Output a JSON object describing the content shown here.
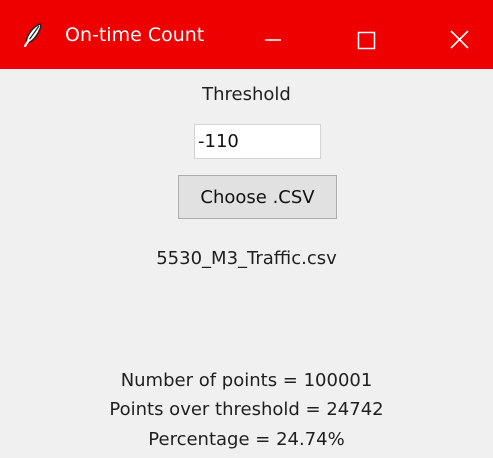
{
  "window": {
    "title": "On-time Count",
    "title_bar_color": "#ee0000",
    "title_text_color": "#ffffff",
    "body_color": "#f0f0f0",
    "icons": {
      "app": "feather-icon",
      "minimize": "minimize-icon",
      "maximize": "maximize-icon",
      "close": "close-icon"
    }
  },
  "form": {
    "threshold_label": "Threshold",
    "threshold_value": "-110",
    "choose_button_label": "Choose .CSV",
    "selected_file": "5530_M3_Traffic.csv"
  },
  "results": {
    "points": "Number of points = 100001",
    "over_threshold": "Points over threshold = 24742",
    "percentage": "Percentage = 24.74%"
  }
}
